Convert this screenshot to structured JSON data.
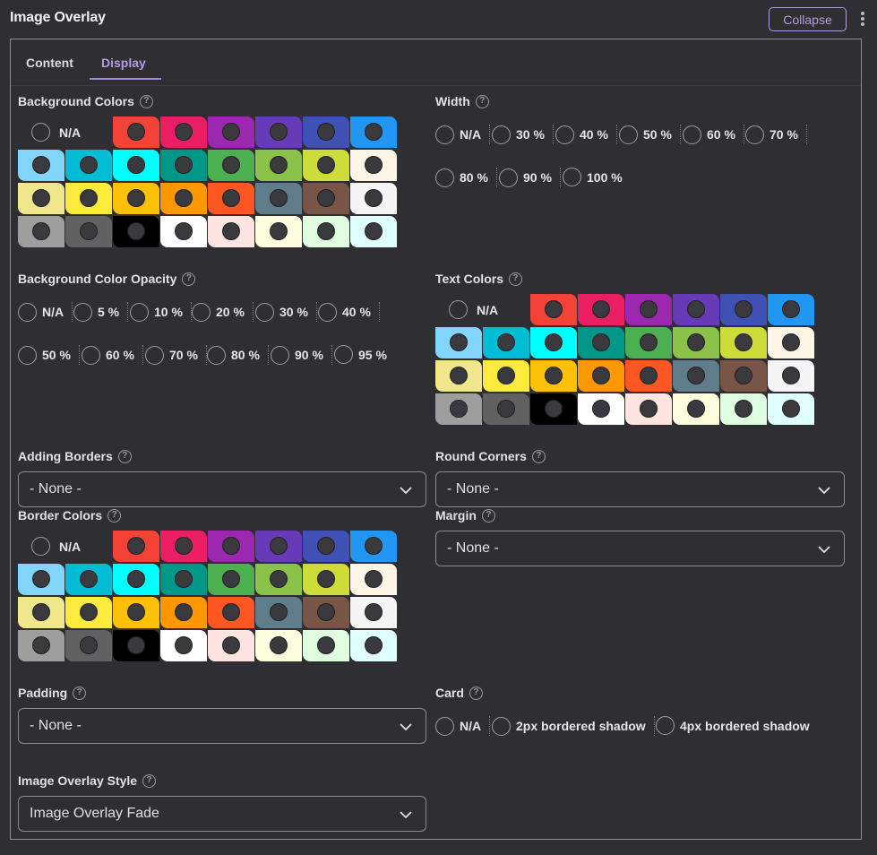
{
  "header": {
    "title": "Image Overlay",
    "collapse_label": "Collapse"
  },
  "tabs": [
    {
      "label": "Content"
    },
    {
      "label": "Display"
    }
  ],
  "active_tab": "Display",
  "colors": {
    "accent": "#b39ddb",
    "swatch_dot": "#3a3a3e",
    "palette": [
      "#f44336",
      "#e91e63",
      "#9c27b0",
      "#673ab7",
      "#3f51b5",
      "#2196f3",
      "#81d4fa",
      "#00bcd4",
      "#00ffff",
      "#009688",
      "#4caf50",
      "#8bc34a",
      "#cddc39",
      "#fdf5e6",
      "#f0e68c",
      "#ffeb3b",
      "#ffc107",
      "#ff9800",
      "#ff5722",
      "#607d8b",
      "#795548",
      "#f5f5f5",
      "#9e9e9e",
      "#616161",
      "#000000",
      "#ffffff",
      "#ffe4e1",
      "#ffffe0",
      "#e0ffe0",
      "#e0ffff"
    ]
  },
  "background_colors": {
    "label": "Background Colors",
    "na_label": "N/A"
  },
  "width": {
    "label": "Width",
    "options": [
      "N/A",
      "30 %",
      "40 %",
      "50 %",
      "60 %",
      "70 %",
      "80 %",
      "90 %",
      "100 %"
    ]
  },
  "bg_opacity": {
    "label": "Background Color Opacity",
    "options": [
      "N/A",
      "5 %",
      "10 %",
      "20 %",
      "30 %",
      "40 %",
      "50 %",
      "60 %",
      "70 %",
      "80 %",
      "90 %",
      "95 %"
    ]
  },
  "text_colors": {
    "label": "Text Colors",
    "na_label": "N/A"
  },
  "adding_borders": {
    "label": "Adding Borders",
    "value": "- None -"
  },
  "round_corners": {
    "label": "Round Corners",
    "value": "- None -"
  },
  "border_colors": {
    "label": "Border Colors",
    "na_label": "N/A"
  },
  "margin": {
    "label": "Margin",
    "value": "- None -"
  },
  "padding": {
    "label": "Padding",
    "value": "- None -"
  },
  "card": {
    "label": "Card",
    "options": [
      "N/A",
      "2px bordered shadow",
      "4px bordered shadow"
    ]
  },
  "image_overlay_style": {
    "label": "Image Overlay Style",
    "value": "Image Overlay Fade"
  }
}
